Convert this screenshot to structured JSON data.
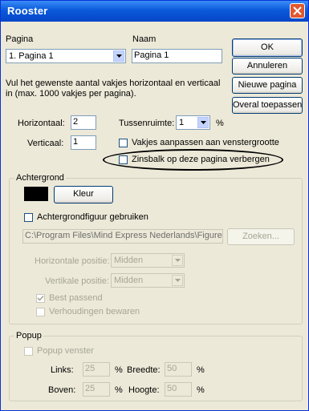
{
  "window": {
    "title": "Rooster"
  },
  "pagina": {
    "label": "Pagina",
    "value": "1. Pagina 1"
  },
  "naam": {
    "label": "Naam",
    "value": "Pagina 1"
  },
  "buttons": {
    "ok": "OK",
    "annuleren": "Annuleren",
    "nieuwe": "Nieuwe pagina",
    "overal": "Overal toepassen"
  },
  "instruction": "Vul het gewenste aantal vakjes horizontaal en verticaal in (max. 1000 vakjes per pagina).",
  "grid": {
    "horizontaal_label": "Horizontaal:",
    "horizontaal_value": "2",
    "verticaal_label": "Verticaal:",
    "verticaal_value": "1",
    "tussenruimte_label": "Tussenruimte:",
    "tussenruimte_value": "1",
    "percent": "%",
    "vakjes_label": "Vakjes aanpassen aan venstergrootte",
    "zinsbalk_label": "Zinsbalk op deze pagina verbergen"
  },
  "achtergrond": {
    "legend": "Achtergrond",
    "color": "#000000",
    "kleur_button": "Kleur",
    "figuur_label": "Achtergrondfiguur gebruiken",
    "path_value": "C:\\Program Files\\Mind Express Nederlands\\Figuren\\b",
    "zoeken_button": "Zoeken...",
    "horizontale_label": "Horizontale positie:",
    "horizontale_value": "Midden",
    "vertikale_label": "Vertikale positie:",
    "vertikale_value": "Midden",
    "best_label": "Best passend",
    "verhoudingen_label": "Verhoudingen bewaren"
  },
  "popup": {
    "legend": "Popup",
    "venster_label": "Popup venster",
    "links_label": "Links:",
    "links_value": "25",
    "breedte_label": "Breedte:",
    "breedte_value": "50",
    "boven_label": "Boven:",
    "boven_value": "25",
    "hoogte_label": "Hoogte:",
    "hoogte_value": "50",
    "percent": "%"
  }
}
